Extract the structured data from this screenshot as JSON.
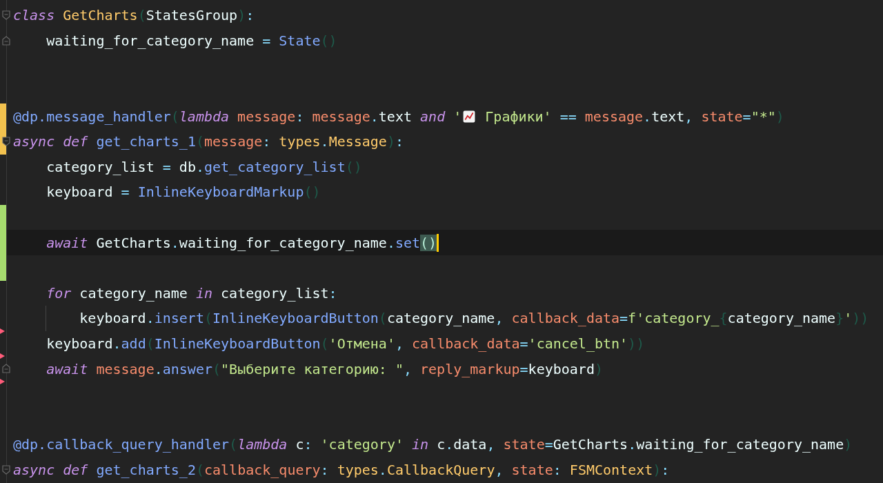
{
  "editor": {
    "lines": [
      {
        "fold_start": true,
        "tokens": [
          {
            "text": "class",
            "kind": "kw"
          },
          {
            "text": " GetCharts",
            "kind": "cls"
          },
          {
            "text": "(",
            "kind": "par"
          },
          {
            "text": "StatesGroup",
            "kind": "pl"
          },
          {
            "text": ")",
            "kind": "par"
          },
          {
            "text": ":",
            "kind": "op"
          }
        ]
      },
      {
        "fold_end": true,
        "tokens": [
          {
            "text": "    waiting_for_category_name ",
            "kind": "pl"
          },
          {
            "text": "=",
            "kind": "op"
          },
          {
            "text": " State",
            "kind": "fn"
          },
          {
            "text": "()",
            "kind": "par"
          }
        ]
      },
      {
        "blank": true
      },
      {
        "blank": true
      },
      {
        "modified": true,
        "tokens": [
          {
            "text": "@dp.message_handler",
            "kind": "fn"
          },
          {
            "text": "(",
            "kind": "par"
          },
          {
            "text": "lambda",
            "kind": "kw"
          },
          {
            "text": " message",
            "kind": "prm"
          },
          {
            "text": ":",
            "kind": "op"
          },
          {
            "text": " message",
            "kind": "prm"
          },
          {
            "text": ".",
            "kind": "op"
          },
          {
            "text": "text ",
            "kind": "pl"
          },
          {
            "text": "and",
            "kind": "kw"
          },
          {
            "text": " '",
            "kind": "str"
          },
          {
            "kind": "emoji"
          },
          {
            "text": " Графики'",
            "kind": "str"
          },
          {
            "text": " ==",
            "kind": "op"
          },
          {
            "text": " message",
            "kind": "prm"
          },
          {
            "text": ".",
            "kind": "op"
          },
          {
            "text": "text",
            "kind": "pl"
          },
          {
            "text": ",",
            "kind": "op"
          },
          {
            "text": " state",
            "kind": "prm"
          },
          {
            "text": "=",
            "kind": "op"
          },
          {
            "text": "\"*\"",
            "kind": "str"
          },
          {
            "text": ")",
            "kind": "par"
          }
        ]
      },
      {
        "modified": true,
        "fold_start": true,
        "tokens": [
          {
            "text": "async",
            "kind": "kw"
          },
          {
            "text": " def",
            "kind": "kw"
          },
          {
            "text": " get_charts_1",
            "kind": "fn"
          },
          {
            "text": "(",
            "kind": "par"
          },
          {
            "text": "message",
            "kind": "prm"
          },
          {
            "text": ":",
            "kind": "op"
          },
          {
            "text": " types",
            "kind": "cls"
          },
          {
            "text": ".",
            "kind": "op"
          },
          {
            "text": "Message",
            "kind": "cls"
          },
          {
            "text": ")",
            "kind": "par"
          },
          {
            "text": ":",
            "kind": "op"
          }
        ]
      },
      {
        "tokens": [
          {
            "text": "    category_list ",
            "kind": "pl"
          },
          {
            "text": "=",
            "kind": "op"
          },
          {
            "text": " db",
            "kind": "pl"
          },
          {
            "text": ".",
            "kind": "op"
          },
          {
            "text": "get_category_list",
            "kind": "fn"
          },
          {
            "text": "()",
            "kind": "par"
          }
        ]
      },
      {
        "tokens": [
          {
            "text": "    keyboard ",
            "kind": "pl"
          },
          {
            "text": "=",
            "kind": "op"
          },
          {
            "text": " InlineKeyboardMarkup",
            "kind": "fn"
          },
          {
            "text": "()",
            "kind": "par"
          }
        ]
      },
      {
        "added": true
      },
      {
        "added": true,
        "current": true,
        "caret": true,
        "tokens": [
          {
            "text": "    await",
            "kind": "kw"
          },
          {
            "text": " GetCharts",
            "kind": "pl"
          },
          {
            "text": ".",
            "kind": "op"
          },
          {
            "text": "waiting_for_category_name",
            "kind": "pl"
          },
          {
            "text": ".",
            "kind": "op"
          },
          {
            "text": "set",
            "kind": "fn"
          },
          {
            "text": "()",
            "kind": "brm"
          }
        ]
      },
      {
        "added": true
      },
      {
        "tokens": [
          {
            "text": "    for",
            "kind": "kw"
          },
          {
            "text": " category_name ",
            "kind": "pl"
          },
          {
            "text": "in",
            "kind": "kw"
          },
          {
            "text": " category_list",
            "kind": "pl"
          },
          {
            "text": ":",
            "kind": "op"
          }
        ]
      },
      {
        "indent_guide": true,
        "marked": true,
        "tokens": [
          {
            "text": "        keyboard",
            "kind": "pl"
          },
          {
            "text": ".",
            "kind": "op"
          },
          {
            "text": "insert",
            "kind": "fn"
          },
          {
            "text": "(",
            "kind": "par"
          },
          {
            "text": "InlineKeyboardButton",
            "kind": "fn"
          },
          {
            "text": "(",
            "kind": "par"
          },
          {
            "text": "category_name",
            "kind": "pl"
          },
          {
            "text": ",",
            "kind": "op"
          },
          {
            "text": " callback_data",
            "kind": "prm"
          },
          {
            "text": "=",
            "kind": "op"
          },
          {
            "text": "f'category_",
            "kind": "str"
          },
          {
            "text": "{",
            "kind": "par"
          },
          {
            "text": "category_name",
            "kind": "pl"
          },
          {
            "text": "}",
            "kind": "par"
          },
          {
            "text": "'",
            "kind": "str"
          },
          {
            "text": "))",
            "kind": "par"
          }
        ]
      },
      {
        "marked": true,
        "tokens": [
          {
            "text": "    keyboard",
            "kind": "pl"
          },
          {
            "text": ".",
            "kind": "op"
          },
          {
            "text": "add",
            "kind": "fn"
          },
          {
            "text": "(",
            "kind": "par"
          },
          {
            "text": "InlineKeyboardButton",
            "kind": "fn"
          },
          {
            "text": "(",
            "kind": "par"
          },
          {
            "text": "'Отмена'",
            "kind": "str"
          },
          {
            "text": ",",
            "kind": "op"
          },
          {
            "text": " callback_data",
            "kind": "prm"
          },
          {
            "text": "=",
            "kind": "op"
          },
          {
            "text": "'cancel_btn'",
            "kind": "str"
          },
          {
            "text": "))",
            "kind": "par"
          }
        ]
      },
      {
        "marked": true,
        "fold_end": true,
        "tokens": [
          {
            "text": "    await",
            "kind": "kw"
          },
          {
            "text": " message",
            "kind": "prm"
          },
          {
            "text": ".",
            "kind": "op"
          },
          {
            "text": "answer",
            "kind": "fn"
          },
          {
            "text": "(",
            "kind": "par"
          },
          {
            "text": "\"Выберите категорию: \"",
            "kind": "str"
          },
          {
            "text": ",",
            "kind": "op"
          },
          {
            "text": " reply_markup",
            "kind": "prm"
          },
          {
            "text": "=",
            "kind": "op"
          },
          {
            "text": "keyboard",
            "kind": "pl"
          },
          {
            "text": ")",
            "kind": "par"
          }
        ]
      },
      {
        "blank": true
      },
      {
        "blank": true
      },
      {
        "tokens": [
          {
            "text": "@dp.callback_query_handler",
            "kind": "fn"
          },
          {
            "text": "(",
            "kind": "par"
          },
          {
            "text": "lambda",
            "kind": "kw"
          },
          {
            "text": " c",
            "kind": "pl"
          },
          {
            "text": ":",
            "kind": "op"
          },
          {
            "text": " 'category'",
            "kind": "str"
          },
          {
            "text": " in",
            "kind": "kw"
          },
          {
            "text": " c",
            "kind": "pl"
          },
          {
            "text": ".",
            "kind": "op"
          },
          {
            "text": "data",
            "kind": "pl"
          },
          {
            "text": ",",
            "kind": "op"
          },
          {
            "text": " state",
            "kind": "prm"
          },
          {
            "text": "=",
            "kind": "op"
          },
          {
            "text": "GetCharts",
            "kind": "pl"
          },
          {
            "text": ".",
            "kind": "op"
          },
          {
            "text": "waiting_for_category_name",
            "kind": "pl"
          },
          {
            "text": ")",
            "kind": "par"
          }
        ]
      },
      {
        "fold_start": true,
        "tokens": [
          {
            "text": "async",
            "kind": "kw"
          },
          {
            "text": " def",
            "kind": "kw"
          },
          {
            "text": " get_charts_2",
            "kind": "fn"
          },
          {
            "text": "(",
            "kind": "par"
          },
          {
            "text": "callback_query",
            "kind": "prm"
          },
          {
            "text": ":",
            "kind": "op"
          },
          {
            "text": " types",
            "kind": "cls"
          },
          {
            "text": ".",
            "kind": "op"
          },
          {
            "text": "CallbackQuery",
            "kind": "cls"
          },
          {
            "text": ",",
            "kind": "op"
          },
          {
            "text": " state",
            "kind": "prm"
          },
          {
            "text": ":",
            "kind": "op"
          },
          {
            "text": " FSMContext",
            "kind": "cls"
          },
          {
            "text": ")",
            "kind": "par"
          },
          {
            "text": ":",
            "kind": "op"
          }
        ]
      }
    ]
  }
}
